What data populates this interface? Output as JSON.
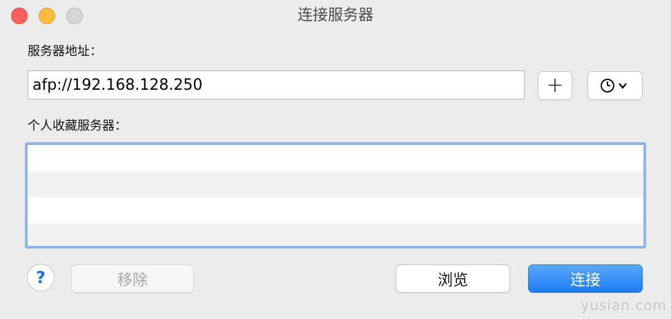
{
  "window": {
    "title": "连接服务器"
  },
  "server_address": {
    "label": "服务器地址：",
    "value": "afp://192.168.128.250",
    "add_label": "+"
  },
  "favorites": {
    "label": "个人收藏服务器：",
    "items": []
  },
  "footer": {
    "help_label": "?",
    "remove_label": "移除",
    "browse_label": "浏览",
    "connect_label": "连接"
  },
  "watermark": "yusian.com",
  "icons": {
    "close": "close-icon",
    "minimize": "minimize-icon",
    "zoom": "zoom-icon",
    "add": "plus-icon",
    "recent": "clock-icon",
    "dropdown": "chevron-down-icon"
  },
  "colors": {
    "accent": "#1d7cf2",
    "focus_ring": "#8fb6e6",
    "close": "#fc605c",
    "minimize": "#fdbc40"
  }
}
